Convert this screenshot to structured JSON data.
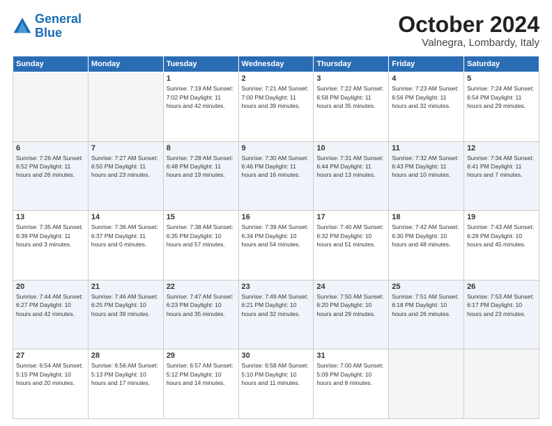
{
  "header": {
    "logo_line1": "General",
    "logo_line2": "Blue",
    "title": "October 2024",
    "subtitle": "Valnegra, Lombardy, Italy"
  },
  "days_of_week": [
    "Sunday",
    "Monday",
    "Tuesday",
    "Wednesday",
    "Thursday",
    "Friday",
    "Saturday"
  ],
  "weeks": [
    {
      "days": [
        {
          "num": "",
          "detail": ""
        },
        {
          "num": "",
          "detail": ""
        },
        {
          "num": "1",
          "detail": "Sunrise: 7:19 AM\nSunset: 7:02 PM\nDaylight: 11 hours and 42 minutes."
        },
        {
          "num": "2",
          "detail": "Sunrise: 7:21 AM\nSunset: 7:00 PM\nDaylight: 11 hours and 39 minutes."
        },
        {
          "num": "3",
          "detail": "Sunrise: 7:22 AM\nSunset: 6:58 PM\nDaylight: 11 hours and 35 minutes."
        },
        {
          "num": "4",
          "detail": "Sunrise: 7:23 AM\nSunset: 6:56 PM\nDaylight: 11 hours and 32 minutes."
        },
        {
          "num": "5",
          "detail": "Sunrise: 7:24 AM\nSunset: 6:54 PM\nDaylight: 11 hours and 29 minutes."
        }
      ]
    },
    {
      "days": [
        {
          "num": "6",
          "detail": "Sunrise: 7:26 AM\nSunset: 6:52 PM\nDaylight: 11 hours and 26 minutes."
        },
        {
          "num": "7",
          "detail": "Sunrise: 7:27 AM\nSunset: 6:50 PM\nDaylight: 11 hours and 23 minutes."
        },
        {
          "num": "8",
          "detail": "Sunrise: 7:28 AM\nSunset: 6:48 PM\nDaylight: 11 hours and 19 minutes."
        },
        {
          "num": "9",
          "detail": "Sunrise: 7:30 AM\nSunset: 6:46 PM\nDaylight: 11 hours and 16 minutes."
        },
        {
          "num": "10",
          "detail": "Sunrise: 7:31 AM\nSunset: 6:44 PM\nDaylight: 11 hours and 13 minutes."
        },
        {
          "num": "11",
          "detail": "Sunrise: 7:32 AM\nSunset: 6:43 PM\nDaylight: 11 hours and 10 minutes."
        },
        {
          "num": "12",
          "detail": "Sunrise: 7:34 AM\nSunset: 6:41 PM\nDaylight: 11 hours and 7 minutes."
        }
      ]
    },
    {
      "days": [
        {
          "num": "13",
          "detail": "Sunrise: 7:35 AM\nSunset: 6:39 PM\nDaylight: 11 hours and 3 minutes."
        },
        {
          "num": "14",
          "detail": "Sunrise: 7:36 AM\nSunset: 6:37 PM\nDaylight: 11 hours and 0 minutes."
        },
        {
          "num": "15",
          "detail": "Sunrise: 7:38 AM\nSunset: 6:35 PM\nDaylight: 10 hours and 57 minutes."
        },
        {
          "num": "16",
          "detail": "Sunrise: 7:39 AM\nSunset: 6:34 PM\nDaylight: 10 hours and 54 minutes."
        },
        {
          "num": "17",
          "detail": "Sunrise: 7:40 AM\nSunset: 6:32 PM\nDaylight: 10 hours and 51 minutes."
        },
        {
          "num": "18",
          "detail": "Sunrise: 7:42 AM\nSunset: 6:30 PM\nDaylight: 10 hours and 48 minutes."
        },
        {
          "num": "19",
          "detail": "Sunrise: 7:43 AM\nSunset: 6:28 PM\nDaylight: 10 hours and 45 minutes."
        }
      ]
    },
    {
      "days": [
        {
          "num": "20",
          "detail": "Sunrise: 7:44 AM\nSunset: 6:27 PM\nDaylight: 10 hours and 42 minutes."
        },
        {
          "num": "21",
          "detail": "Sunrise: 7:46 AM\nSunset: 6:25 PM\nDaylight: 10 hours and 39 minutes."
        },
        {
          "num": "22",
          "detail": "Sunrise: 7:47 AM\nSunset: 6:23 PM\nDaylight: 10 hours and 35 minutes."
        },
        {
          "num": "23",
          "detail": "Sunrise: 7:49 AM\nSunset: 6:21 PM\nDaylight: 10 hours and 32 minutes."
        },
        {
          "num": "24",
          "detail": "Sunrise: 7:50 AM\nSunset: 6:20 PM\nDaylight: 10 hours and 29 minutes."
        },
        {
          "num": "25",
          "detail": "Sunrise: 7:51 AM\nSunset: 6:18 PM\nDaylight: 10 hours and 26 minutes."
        },
        {
          "num": "26",
          "detail": "Sunrise: 7:53 AM\nSunset: 6:17 PM\nDaylight: 10 hours and 23 minutes."
        }
      ]
    },
    {
      "days": [
        {
          "num": "27",
          "detail": "Sunrise: 6:54 AM\nSunset: 5:15 PM\nDaylight: 10 hours and 20 minutes."
        },
        {
          "num": "28",
          "detail": "Sunrise: 6:56 AM\nSunset: 5:13 PM\nDaylight: 10 hours and 17 minutes."
        },
        {
          "num": "29",
          "detail": "Sunrise: 6:57 AM\nSunset: 5:12 PM\nDaylight: 10 hours and 14 minutes."
        },
        {
          "num": "30",
          "detail": "Sunrise: 6:58 AM\nSunset: 5:10 PM\nDaylight: 10 hours and 11 minutes."
        },
        {
          "num": "31",
          "detail": "Sunrise: 7:00 AM\nSunset: 5:09 PM\nDaylight: 10 hours and 8 minutes."
        },
        {
          "num": "",
          "detail": ""
        },
        {
          "num": "",
          "detail": ""
        }
      ]
    }
  ]
}
